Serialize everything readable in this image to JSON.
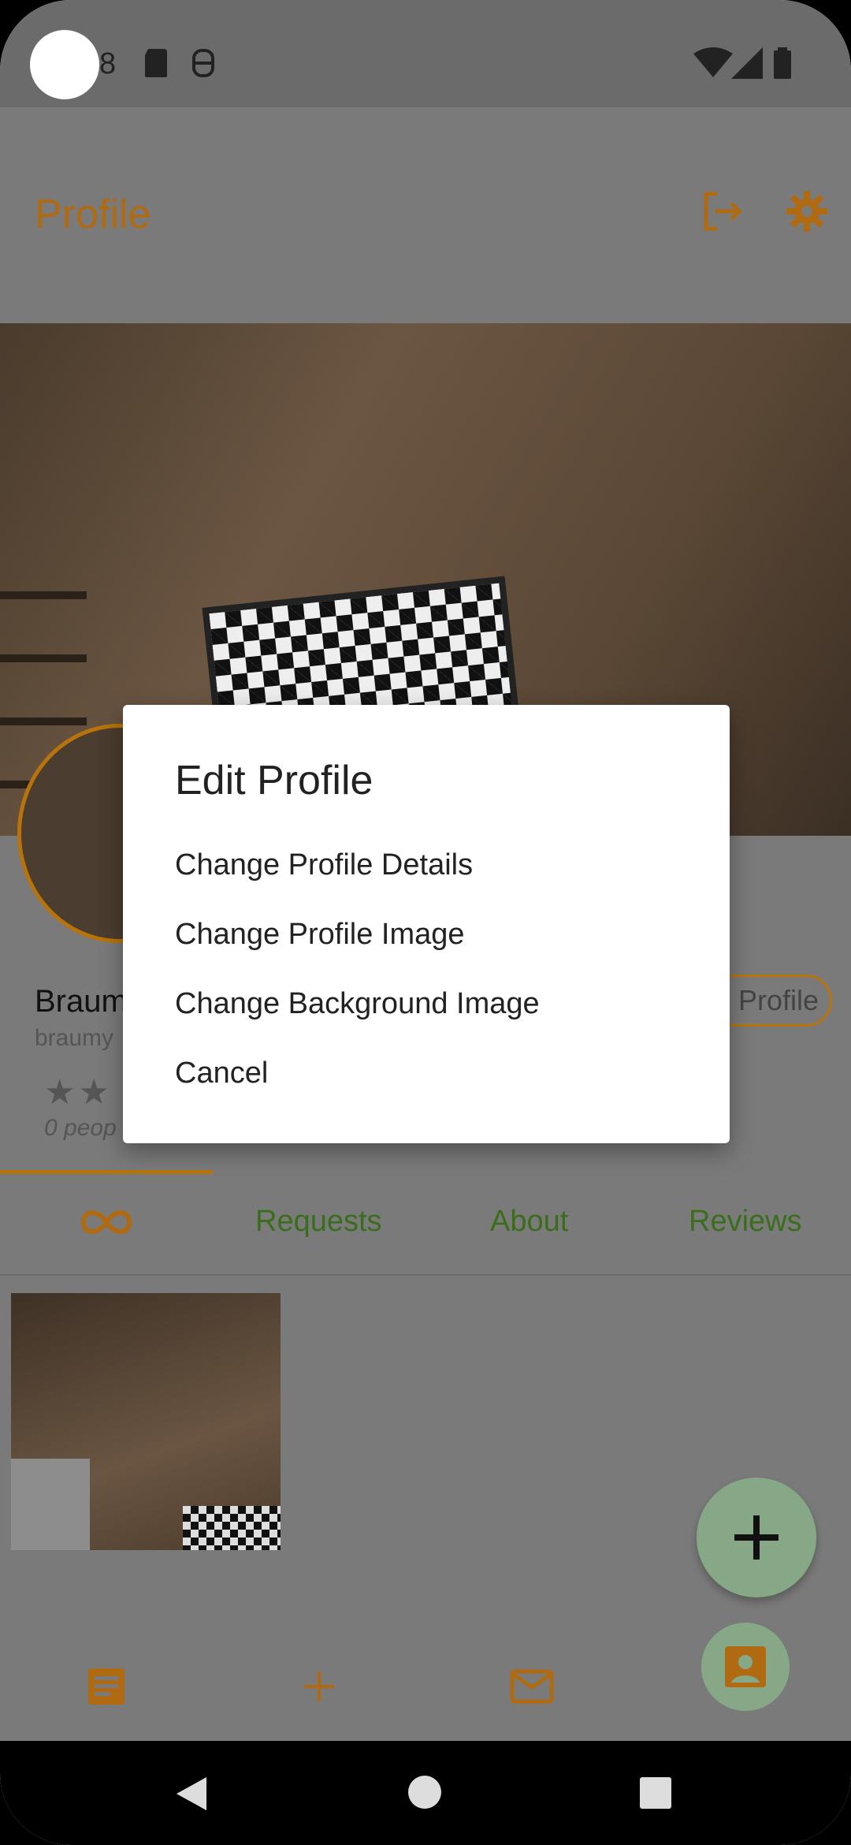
{
  "status_bar": {
    "time_fragment": "8"
  },
  "app_bar": {
    "title": "Profile"
  },
  "profile": {
    "name": "Braum",
    "handle": "braumy",
    "stars": "★★",
    "rating_text": "0 peop",
    "edit_button_label": "Profile"
  },
  "tabs": [
    {
      "label": "∞"
    },
    {
      "label": "Requests"
    },
    {
      "label": "About"
    },
    {
      "label": "Reviews"
    }
  ],
  "dialog": {
    "title": "Edit Profile",
    "items": [
      {
        "label": "Change Profile Details"
      },
      {
        "label": "Change Profile Image"
      },
      {
        "label": "Change Background Image"
      },
      {
        "label": "Cancel"
      }
    ]
  },
  "colors": {
    "accent": "#b06a12",
    "tab_text": "#3a6e1c",
    "fab": "#87a886"
  },
  "icons": {
    "app_bar": [
      "logout-icon",
      "gear-icon"
    ],
    "bottom_nav": [
      "document-icon",
      "plus-icon",
      "mail-icon",
      "contact-icon"
    ],
    "system_nav": [
      "back-icon",
      "home-icon",
      "recents-icon"
    ]
  }
}
